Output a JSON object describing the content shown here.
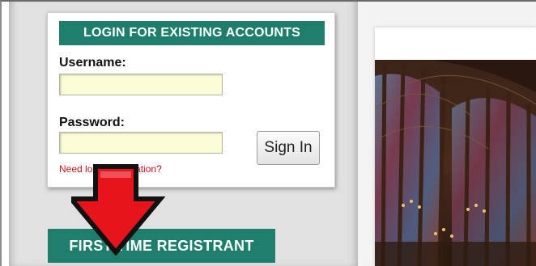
{
  "login": {
    "header": "LOGIN FOR EXISTING ACCOUNTS",
    "username_label": "Username:",
    "password_label": "Password:",
    "username_value": "",
    "password_value": "",
    "sign_in_label": "Sign In",
    "help_link": "Need login information?"
  },
  "registration": {
    "button_label": "FIRST-TIME REGISTRANT"
  },
  "colors": {
    "brand_green": "#1f7d6b",
    "link_red": "#c0141b",
    "arrow_red": "#e8141c",
    "input_bg": "#fbfdd6"
  },
  "icons": {
    "arrow": "down-arrow-icon"
  }
}
